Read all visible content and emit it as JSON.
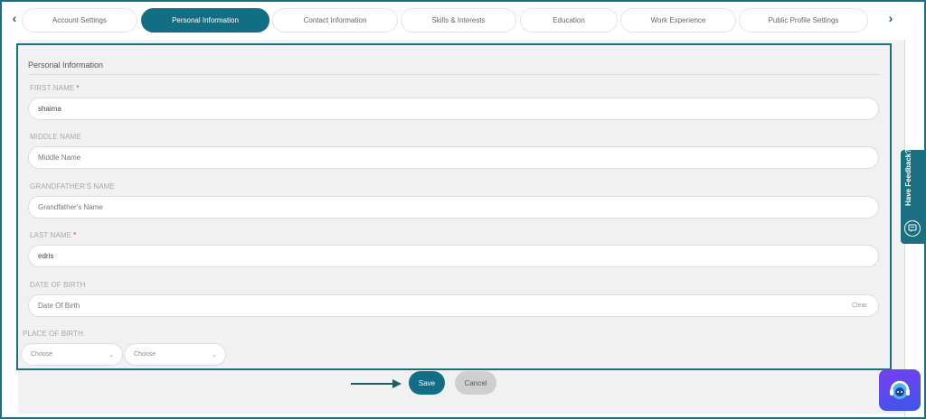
{
  "tabs": [
    {
      "label": "Account Settings",
      "active": false
    },
    {
      "label": "Personal Information",
      "active": true
    },
    {
      "label": "Contact Information",
      "active": false
    },
    {
      "label": "Skills & Interests",
      "active": false
    },
    {
      "label": "Education",
      "active": false
    },
    {
      "label": "Work Experience",
      "active": false
    },
    {
      "label": "Public Profile Settings",
      "active": false
    }
  ],
  "nav": {
    "prev_icon": "chevron-left-icon",
    "next_icon": "chevron-right-icon",
    "prev_glyph": "‹",
    "next_glyph": "›"
  },
  "form": {
    "section_title": "Personal Information",
    "required_mark": "*",
    "first_name": {
      "label": "FIRST NAME",
      "value": "shaima",
      "placeholder": ""
    },
    "middle_name": {
      "label": "MIDDLE NAME",
      "value": "",
      "placeholder": "Middle Name"
    },
    "grandfather_name": {
      "label": "GRANDFATHER'S NAME",
      "value": "",
      "placeholder": "Grandfather's Name"
    },
    "last_name": {
      "label": "LAST NAME",
      "value": "edris",
      "placeholder": ""
    },
    "date_of_birth": {
      "label": "DATE OF BIRTH",
      "value": "",
      "placeholder": "Date Of Birth",
      "clear_label": "Clear"
    },
    "place_of_birth": {
      "label": "PLACE OF BIRTH",
      "select_1": "Choose",
      "select_2": "Choose"
    }
  },
  "actions": {
    "save_label": "Save",
    "cancel_label": "Cancel"
  },
  "feedback": {
    "label": "Have Feedback?",
    "icon": "feedback-icon"
  },
  "colors": {
    "accent": "#126e84",
    "required": "#e53935",
    "panel_border": "#1a6f80"
  }
}
